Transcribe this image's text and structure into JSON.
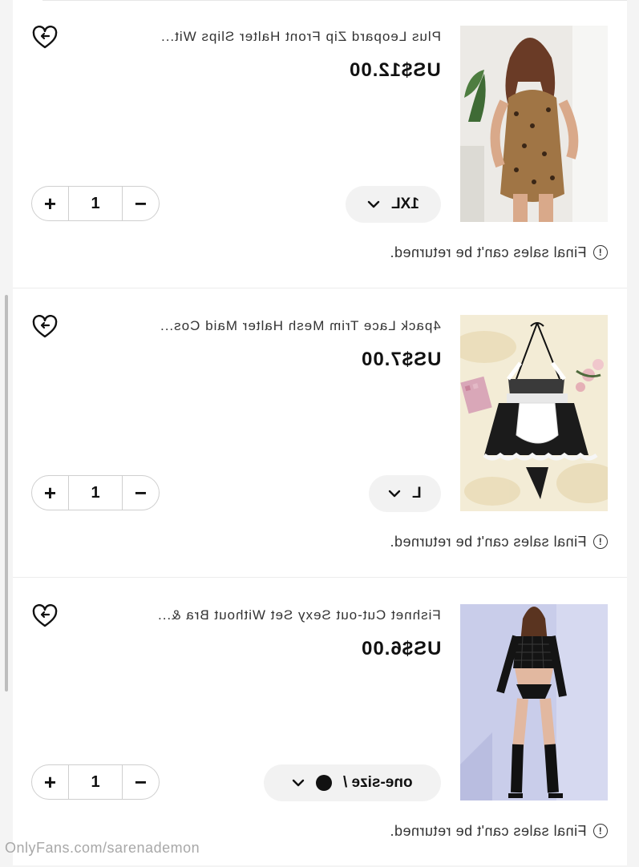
{
  "items": [
    {
      "title": "Plus Leopard Zip Front Halter Slips Wit...",
      "price": "US$12.00",
      "size": "1XL",
      "quantity": "1",
      "notice": "Final sales can't be returned."
    },
    {
      "title": "4pack Lace Trim Mesh Halter Maid Cos...",
      "price": "US$7.00",
      "size": "L",
      "quantity": "1",
      "notice": "Final sales can't be returned."
    },
    {
      "title": "Fishnet Cut-out Sexy Set Without Bra &...",
      "price": "US$6.00",
      "size": "one-size /",
      "quantity": "1",
      "notice": "Final sales can't be returned."
    }
  ],
  "controls": {
    "plus": "+",
    "minus": "−"
  },
  "watermark": "OnlyFans.com/sarenademon"
}
